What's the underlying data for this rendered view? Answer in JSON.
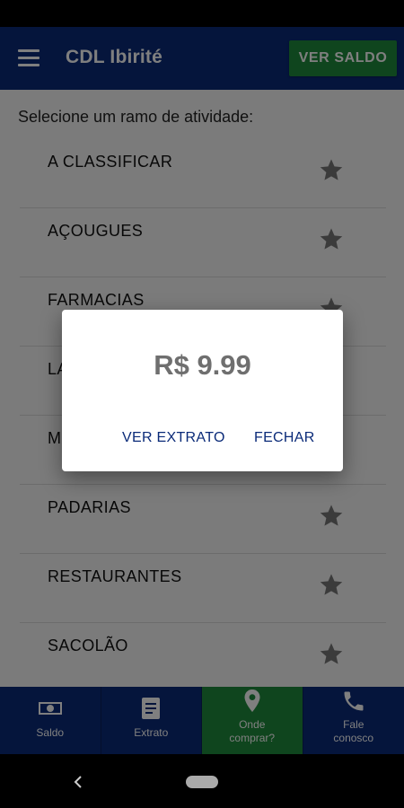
{
  "app": {
    "title": "CDL Ibirité",
    "ver_saldo_label": "VER SALDO"
  },
  "content": {
    "prompt": "Selecione um ramo de atividade:",
    "items": [
      {
        "label": "A CLASSIFICAR"
      },
      {
        "label": "AÇOUGUES"
      },
      {
        "label": "FARMACIAS"
      },
      {
        "label": "LA"
      },
      {
        "label": "M"
      },
      {
        "label": "PADARIAS"
      },
      {
        "label": "RESTAURANTES"
      },
      {
        "label": "SACOLÃO"
      }
    ]
  },
  "dialog": {
    "amount": "R$ 9.99",
    "ver_extrato_label": "VER EXTRATO",
    "fechar_label": "FECHAR"
  },
  "bottom_nav": [
    {
      "label": "Saldo",
      "icon": "money-icon"
    },
    {
      "label": "Extrato",
      "icon": "document-icon"
    },
    {
      "label": "Onde\ncomprar?",
      "icon": "location-pin-icon",
      "active": true
    },
    {
      "label": "Fale\nconosco",
      "icon": "phone-icon"
    }
  ],
  "colors": {
    "primary": "#0a2a78",
    "accent": "#1f8a3d",
    "star": "#777777"
  }
}
